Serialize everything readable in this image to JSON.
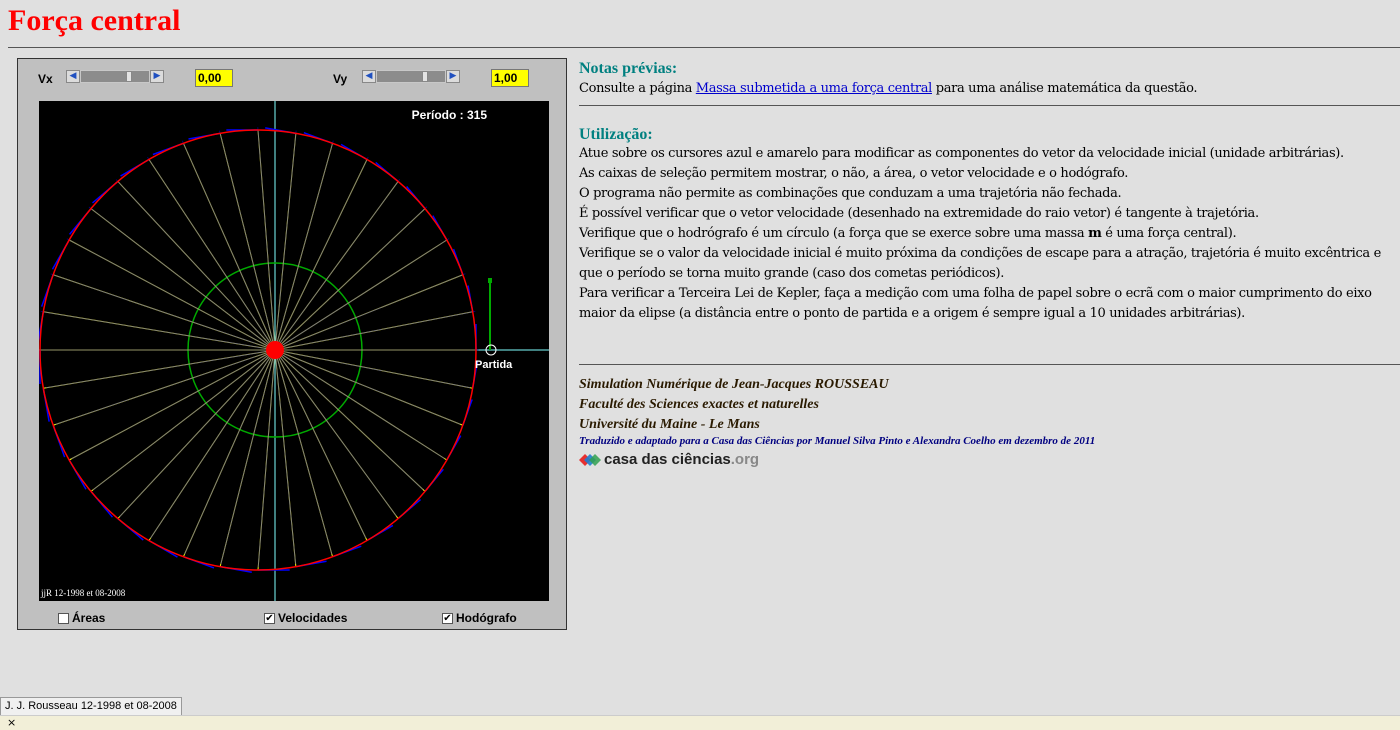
{
  "page": {
    "title": "Força central"
  },
  "applet": {
    "vx_label": "Vx",
    "vx_value": "0,00",
    "vx_level": 0.72,
    "vy_label": "Vy",
    "vy_value": "1,00",
    "vy_level": 0.72,
    "periodo": "Período : 315",
    "partida": "Partida",
    "credit": "jjR 12-1998 et 08-2008",
    "checkboxes": [
      {
        "label": "Áreas",
        "checked": false
      },
      {
        "label": "Velocidades",
        "checked": true
      },
      {
        "label": "Hodógrafo",
        "checked": true
      }
    ],
    "colors": {
      "orbit": "#ff0000",
      "radius": "#ffff00",
      "velocity": "#0000ff",
      "hodograph": "#00aa00",
      "axes": "#80ffff",
      "sun": "#ff0000"
    }
  },
  "notes": {
    "title": "Notas prévias:",
    "before_link": "Consulte a página ",
    "link": "Massa submetida a uma força central",
    "after_link": " para uma análise matemática da questão."
  },
  "usage": {
    "title": "Utilização:",
    "lines": [
      "Atue sobre os cursores azul e amarelo para modificar as componentes do vetor da velocidade inicial (unidade arbitrárias).",
      "As caixas de seleção permitem mostrar, o não, a área, o vetor velocidade e o hodógrafo.",
      "O programa não permite as combinações que conduzam a uma trajetória não fechada.",
      "É possível verificar que o vetor velocidade (desenhado na extremidade do raio vetor) é tangente à trajetória.",
      "Verifique que o hodrógrafo é um círculo (a força que se exerce sobre uma massa m é uma força central).",
      "Verifique se o valor da velocidade inicial é muito próxima da condições de escape para a atração, trajetória é muito excêntrica e que o período se torna muito grande (caso dos cometas periódicos).",
      "Para verificar a Terceira Lei de Kepler, faça a medição com uma folha de papel sobre o ecrã com o maior cumprimento do eixo maior da elipse (a distância entre o ponto de partida e a origem é sempre igual a 10 unidades arbitrárias)."
    ]
  },
  "credits": {
    "line1": "Simulation Numérique de Jean-Jacques ROUSSEAU",
    "line2": "Faculté des Sciences exactes et naturelles",
    "line3": "Université du Maine - Le Mans",
    "translation": "Traduzido e adaptado para a Casa das Ciências por Manuel Silva Pinto e Alexandra Coelho em dezembro de 2011",
    "logo_main": "casa das ciências",
    "logo_suffix": ".org"
  },
  "status": {
    "text": "J. J. Rousseau 12-1998 et 08-2008",
    "close": "×"
  }
}
